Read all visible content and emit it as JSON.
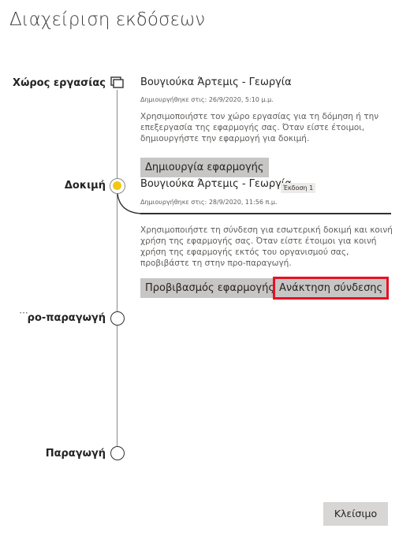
{
  "page": {
    "title": "Διαχείριση εκδόσεων"
  },
  "stages": {
    "workspace": {
      "label": "Χώρος εργασίας",
      "name": "Βουγιούκα Άρτεμις - Γεωργία",
      "created": "Δημιουργήθηκε στις: 26/9/2020, 5:10 μ.μ.",
      "description": "Χρησιμοποιήστε τον χώρο εργασίας για τη δόμηση ή την επεξεργασία της εφαρμογής σας. Όταν είστε έτοιμοι, δημιουργήστε την εφαρμογή για δοκιμή.",
      "create_button": "Δημιουργία εφαρμογής",
      "icon": "workspace-stack-icon"
    },
    "test": {
      "label": "Δοκιμή",
      "name": "Βουγιούκα Άρτεμις - Γεωργία",
      "version_badge": "Έκδοση 1",
      "created": "Δημιουργήθηκε στις: 28/9/2020, 11:56 π.μ.",
      "description": "Χρησιμοποιήστε τη σύνδεση για εσωτερική δοκιμή και κοινή χρήση της εφαρμογής σας. Όταν είστε έτοιμοι για κοινή χρήση της εφαρμογής εκτός του οργανισμού σας, προβιβάστε τη στην προ-παραγωγή.",
      "promote_button": "Προβιβασμός εφαρμογής",
      "get_link_button": "Ανάκτηση σύνδεσης",
      "indicator_color": "#f2c811"
    },
    "preproduction": {
      "label": "ρο-παραγωγή",
      "more_icon": "···"
    },
    "production": {
      "label": "Παραγωγή"
    }
  },
  "footer": {
    "close_button": "Κλείσιμο"
  },
  "colors": {
    "highlight_border": "#e81123",
    "button_bg": "#c8c6c4"
  }
}
